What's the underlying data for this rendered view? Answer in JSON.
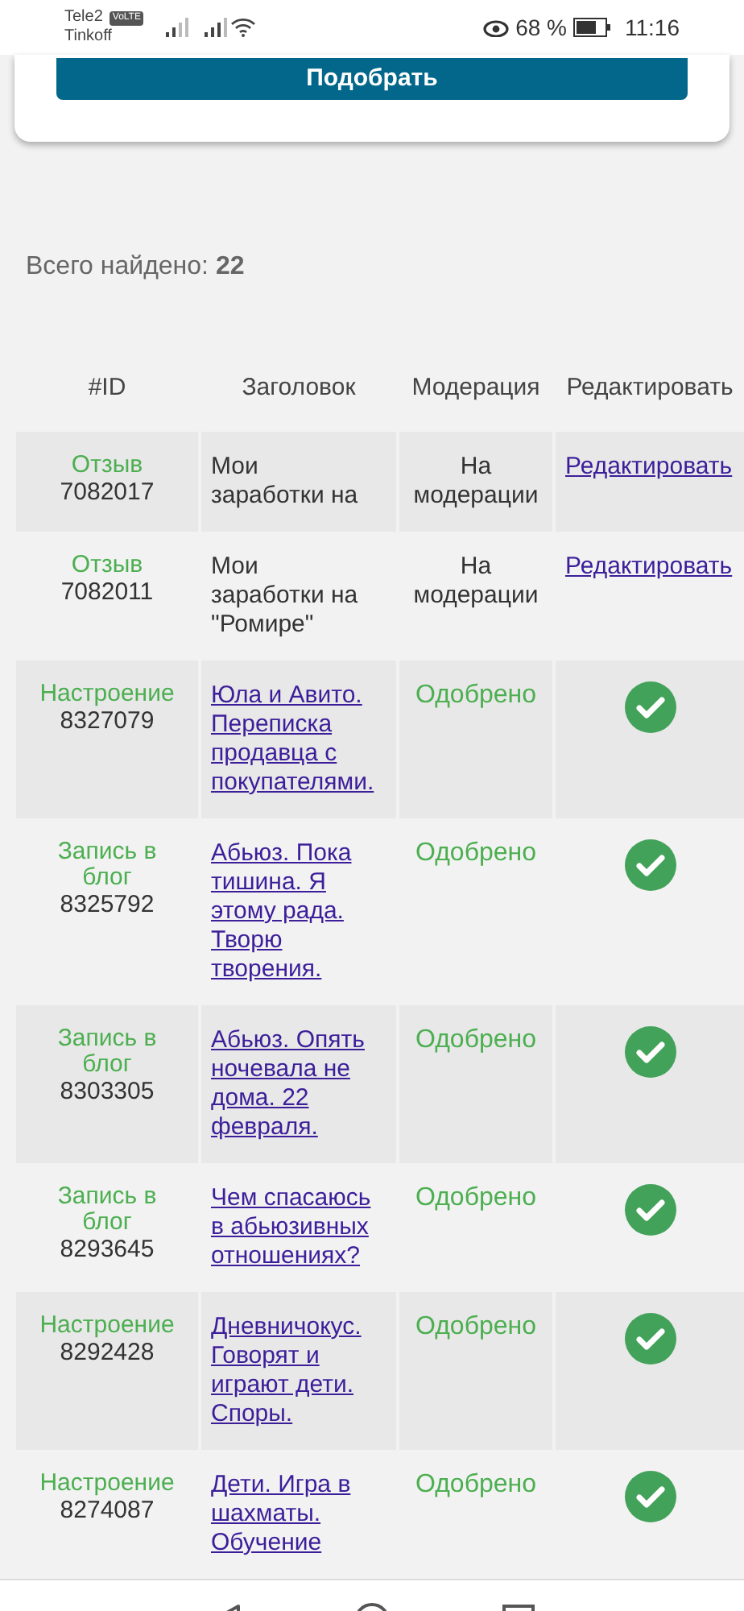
{
  "status_bar": {
    "carrier_1": "Tele2",
    "network_badge": "VoLTE",
    "carrier_2": "Tinkoff",
    "battery": "68 %",
    "time": "11:16"
  },
  "filter_card": {
    "button": "Подобрать"
  },
  "total": "Всего найдено: **22**",
  "table": {
    "columns": [
      "#ID",
      "Заголовок",
      "Модерация",
      "Редактировать"
    ],
    "rows": [
      {
        "type": "Отзыв",
        "id": "7082017",
        "title": "Мои заработки на",
        "status": "На модерации",
        "kind": "pending",
        "edit": "Редактировать"
      },
      {
        "type": "Отзыв",
        "id": "7082011",
        "title": "Мои заработки на \"Ромире\"",
        "status": "На модерации",
        "kind": "pending",
        "edit": "Редактировать"
      },
      {
        "type": "Настроение",
        "id": "8327079",
        "title": "Юла и Авито. Переписка продавца с покупателями.",
        "status": "Одобрено",
        "kind": "approved"
      },
      {
        "type": "Запись в блог",
        "id": "8325792",
        "title": "Абьюз. Пока тишина. Я этому рада. Творю творения.",
        "status": "Одобрено",
        "kind": "approved"
      },
      {
        "type": "Запись в блог",
        "id": "8303305",
        "title": "Абьюз. Опять ночевала не дома. 22 февраля.",
        "status": "Одобрено",
        "kind": "approved"
      },
      {
        "type": "Запись в блог",
        "id": "8293645",
        "title": "Чем спасаюсь в абьюзивных отношениях?",
        "status": "Одобрено",
        "kind": "approved"
      },
      {
        "type": "Настроение",
        "id": "8292428",
        "title": "Дневничокус. Говорят и играют дети. Споры.",
        "status": "Одобрено",
        "kind": "approved"
      },
      {
        "type": "Настроение",
        "id": "8274087",
        "title": "Дети. Игра в шахматы. Обучение",
        "status": "Одобрено",
        "kind": "approved"
      }
    ]
  }
}
